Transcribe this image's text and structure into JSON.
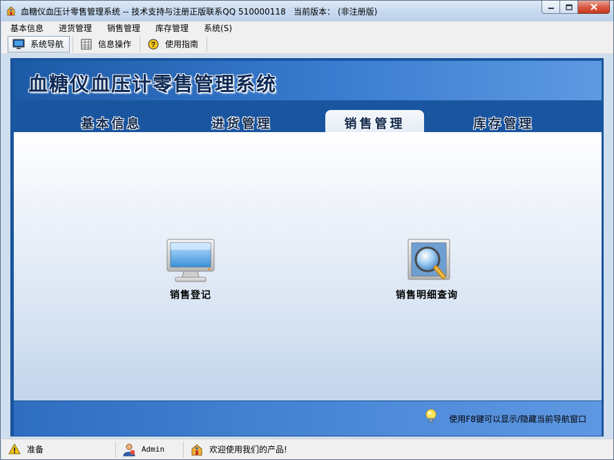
{
  "window": {
    "title": "血糖仪血压计零售管理系统 -- 技术支持与注册正版联系QQ 510000118   当前版本： (非注册版)"
  },
  "menubar": {
    "items": [
      "基本信息",
      "进货管理",
      "销售管理",
      "库存管理",
      "系统(S)"
    ]
  },
  "toolbar": {
    "items": [
      {
        "label": "系统导航",
        "icon": "monitor-icon",
        "active": true
      },
      {
        "label": "信息操作",
        "icon": "grid-icon",
        "active": false
      },
      {
        "label": "使用指南",
        "icon": "help-icon",
        "active": false
      }
    ]
  },
  "banner": {
    "title": "血糖仪血压计零售管理系统"
  },
  "tabs": [
    {
      "label": "基本信息",
      "selected": false
    },
    {
      "label": "进货管理",
      "selected": false
    },
    {
      "label": "销售管理",
      "selected": true
    },
    {
      "label": "库存管理",
      "selected": false
    }
  ],
  "nav_items": [
    {
      "label": "销售登记",
      "icon": "monitor-screen-icon"
    },
    {
      "label": "销售明细查询",
      "icon": "magnifier-icon"
    }
  ],
  "hint": {
    "text": "使用F8键可以显示/隐藏当前导航窗口",
    "icon": "lightbulb-icon"
  },
  "statusbar": {
    "status": "准备",
    "user": "Admin",
    "message": "欢迎使用我们的产品!"
  },
  "colors": {
    "banner_dark": "#1c5aa6",
    "banner_light": "#5e9ae2",
    "tab_strip": "#1a55a0",
    "close_button": "#d9553e"
  }
}
